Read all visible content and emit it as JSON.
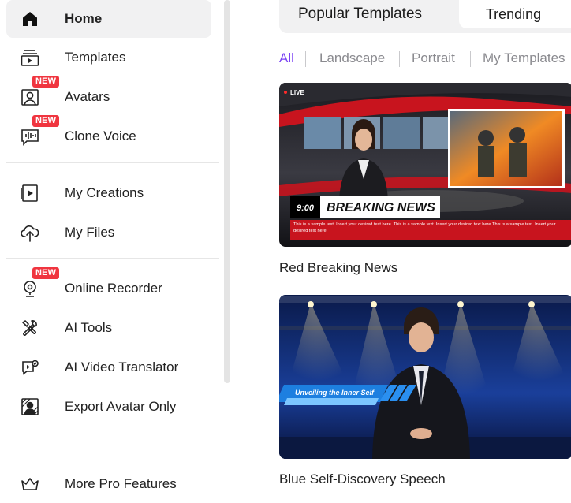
{
  "sidebar": {
    "items": [
      {
        "label": "Home",
        "icon": "home-icon",
        "active": true
      },
      {
        "label": "Templates",
        "icon": "templates-icon"
      },
      {
        "label": "Avatars",
        "icon": "avatar-icon",
        "badge": "NEW"
      },
      {
        "label": "Clone Voice",
        "icon": "voice-wave-icon",
        "badge": "NEW"
      },
      {
        "label": "My Creations",
        "icon": "play-square-icon"
      },
      {
        "label": "My Files",
        "icon": "cloud-upload-icon"
      },
      {
        "label": "Online Recorder",
        "icon": "webcam-icon",
        "badge": "NEW"
      },
      {
        "label": "AI Tools",
        "icon": "tools-icon"
      },
      {
        "label": "AI Video Translator",
        "icon": "video-translate-icon"
      },
      {
        "label": "Export Avatar Only",
        "icon": "avatar-portrait-icon"
      },
      {
        "label": "More Pro Features",
        "icon": "crown-icon"
      }
    ]
  },
  "tabs": {
    "popular": "Popular Templates",
    "trending": "Trending"
  },
  "filters": [
    "All",
    "Landscape",
    "Portrait",
    "My Templates"
  ],
  "cards": [
    {
      "title": "Red Breaking News",
      "live": "LIVE",
      "time": "9:00",
      "headline": "BREAKING NEWS",
      "ticker": "This is a sample text. Insert your desired text here. This is a sample text. Insert your desired text here.This is a sample text. Insert your desired text here."
    },
    {
      "title": "Blue Self-Discovery Speech",
      "banner": "Unveiling the Inner Self"
    }
  ],
  "colors": {
    "accent": "#7a42f4",
    "badge": "#f0353f",
    "news_red": "#c8141e"
  }
}
